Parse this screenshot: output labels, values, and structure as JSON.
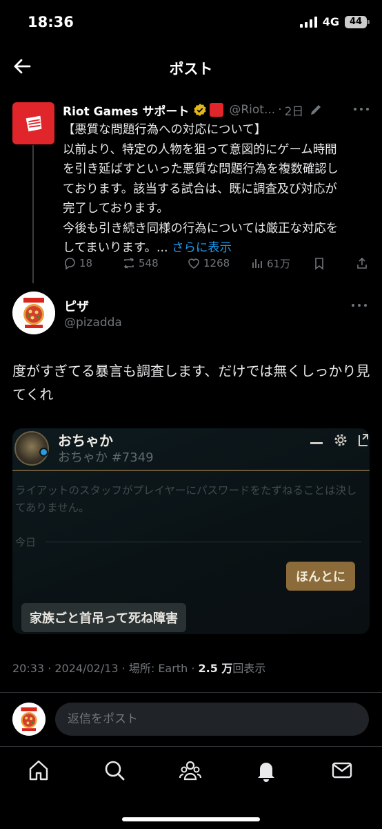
{
  "status_bar": {
    "time": "18:36",
    "network": "4G",
    "battery": "44"
  },
  "nav": {
    "title": "ポスト"
  },
  "parent_post": {
    "author_name": "Riot Games サポート",
    "handle": "@Riot...",
    "dot": "·",
    "time": "2日",
    "text_lines": [
      "【悪質な問題行為への対応について】",
      "以前より、特定の人物を狙って意図的にゲーム時間",
      "を引き延ばすといった悪質な問題行為を複数確認し",
      "ております。該当する試合は、既に調査及び対応が",
      "完了しております。",
      "今後も引き続き同様の行為については厳正な対応を",
      "してまいります。... "
    ],
    "show_more": "さらに表示",
    "replies": "18",
    "reposts": "548",
    "likes": "1268",
    "views": "61万"
  },
  "post": {
    "author_name": "ピザ",
    "handle": "@pizadda",
    "text": "度がすぎてる暴言も調査します、だけでは無くしっかり見てくれ",
    "image": {
      "name": "おちゃか",
      "tag": "おちゃか #7349",
      "notice": "ライアットのスタッフがプレイヤーにパスワードをたずねることは決してありません。",
      "today": "今日",
      "message_right": "ほんとに",
      "message_left": "家族ごと首吊って死ね障害"
    },
    "meta": {
      "time": "20:33 · 2024/02/13 · 場所: Earth · ",
      "views_count": "2.5 万",
      "views_label": "回表示"
    }
  },
  "reply_bar": {
    "placeholder": "返信をポスト"
  },
  "colors": {
    "background": "#000000",
    "link": "#1d9bf0",
    "secondary_text": "#71767b",
    "riot_red": "#e0252b",
    "verified_gold": "#e2b719"
  },
  "icons": [
    "back-arrow-icon",
    "verified-badge-icon",
    "riot-affiliate-icon",
    "edit-icon",
    "more-icon",
    "reply-icon",
    "repost-icon",
    "like-icon",
    "views-icon",
    "bookmark-icon",
    "share-icon",
    "home-icon",
    "search-icon",
    "communities-icon",
    "notifications-icon",
    "messages-icon"
  ]
}
